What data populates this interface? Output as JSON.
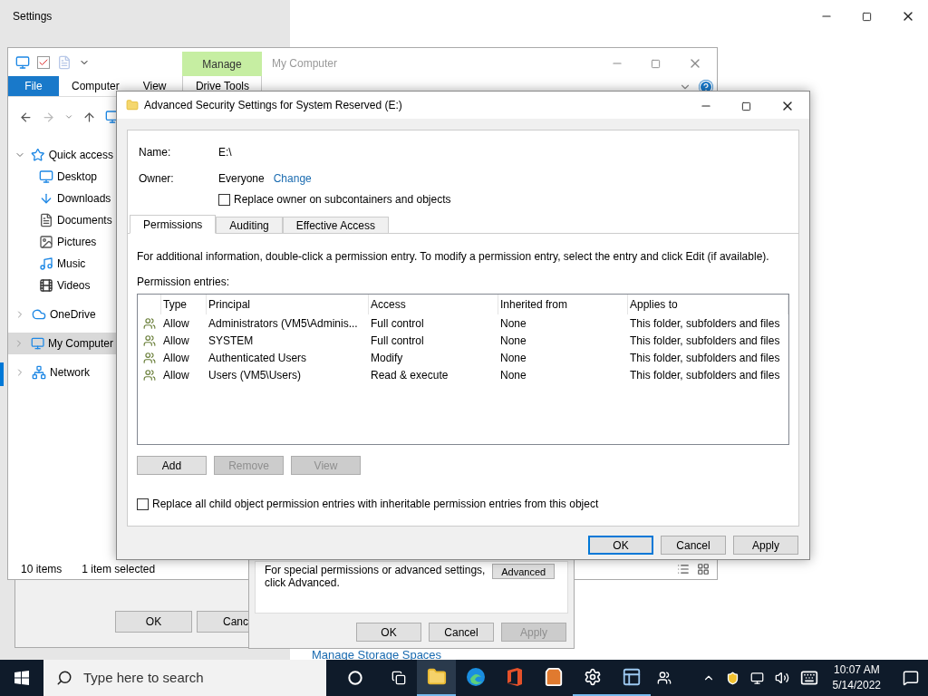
{
  "settings_window": {
    "title": "Settings",
    "link": "Manage Storage Spaces"
  },
  "explorer": {
    "context_tab": "Manage",
    "title": "My Computer",
    "file_tab": "File",
    "ribbon_tabs": [
      "Computer",
      "View",
      "Drive Tools"
    ],
    "nav_tree": [
      {
        "label": "Quick access",
        "expanded": true,
        "selected": false,
        "children": [
          {
            "label": "Desktop",
            "selected": false
          },
          {
            "label": "Downloads",
            "selected": false
          },
          {
            "label": "Documents",
            "selected": false
          },
          {
            "label": "Pictures",
            "selected": false
          },
          {
            "label": "Music",
            "selected": false
          },
          {
            "label": "Videos",
            "selected": false
          }
        ]
      },
      {
        "label": "OneDrive",
        "expanded": false,
        "selected": false
      },
      {
        "label": "My Computer",
        "expanded": false,
        "selected": true
      },
      {
        "label": "Network",
        "expanded": false,
        "selected": false
      }
    ],
    "status": [
      "10 items",
      "1 item selected"
    ]
  },
  "back_dialog": {
    "buttons": [
      "OK",
      "Canc"
    ]
  },
  "properties_dialog": {
    "text_lines": [
      "For special permissions or advanced settings,",
      "click Advanced."
    ],
    "advanced_button": "Advanced",
    "buttons": [
      {
        "label": "OK",
        "disabled": false
      },
      {
        "label": "Cancel",
        "disabled": false
      },
      {
        "label": "Apply",
        "disabled": true
      }
    ]
  },
  "security_dialog": {
    "title": "Advanced Security Settings for System Reserved (E:)",
    "name_label": "Name:",
    "name_value": "E:\\",
    "owner_label": "Owner:",
    "owner_value": "Everyone",
    "change_link": "Change",
    "replace_owner": {
      "label": "Replace owner on subcontainers and objects",
      "checked": false
    },
    "tabs": [
      {
        "label": "Permissions",
        "selected": true
      },
      {
        "label": "Auditing",
        "selected": false
      },
      {
        "label": "Effective Access",
        "selected": false
      }
    ],
    "info": "For additional information, double-click a permission entry. To modify a permission entry, select the entry and click Edit (if available).",
    "entries_label": "Permission entries:",
    "columns": [
      "Type",
      "Principal",
      "Access",
      "Inherited from",
      "Applies to"
    ],
    "rows": [
      {
        "type": "Allow",
        "principal": "Administrators (VM5\\Adminis...",
        "access": "Full control",
        "inherited": "None",
        "applies": "This folder, subfolders and files"
      },
      {
        "type": "Allow",
        "principal": "SYSTEM",
        "access": "Full control",
        "inherited": "None",
        "applies": "This folder, subfolders and files"
      },
      {
        "type": "Allow",
        "principal": "Authenticated Users",
        "access": "Modify",
        "inherited": "None",
        "applies": "This folder, subfolders and files"
      },
      {
        "type": "Allow",
        "principal": "Users (VM5\\Users)",
        "access": "Read & execute",
        "inherited": "None",
        "applies": "This folder, subfolders and files"
      }
    ],
    "action_buttons": [
      {
        "label": "Add",
        "disabled": false
      },
      {
        "label": "Remove",
        "disabled": true
      },
      {
        "label": "View",
        "disabled": true
      }
    ],
    "replace_child": {
      "label": "Replace all child object permission entries with inheritable permission entries from this object",
      "checked": false
    },
    "buttons": [
      {
        "label": "OK",
        "default": true
      },
      {
        "label": "Cancel",
        "default": false
      },
      {
        "label": "Apply",
        "default": false
      }
    ]
  },
  "taskbar": {
    "search_placeholder": "Type here to search",
    "apps": [
      {
        "running": true,
        "active": true
      },
      {
        "running": false,
        "active": false
      },
      {
        "running": false,
        "active": false
      },
      {
        "running": false,
        "active": false
      },
      {
        "running": true,
        "active": false
      },
      {
        "running": true,
        "active": false
      }
    ],
    "time": "10:07 AM",
    "date": "5/14/2022"
  }
}
